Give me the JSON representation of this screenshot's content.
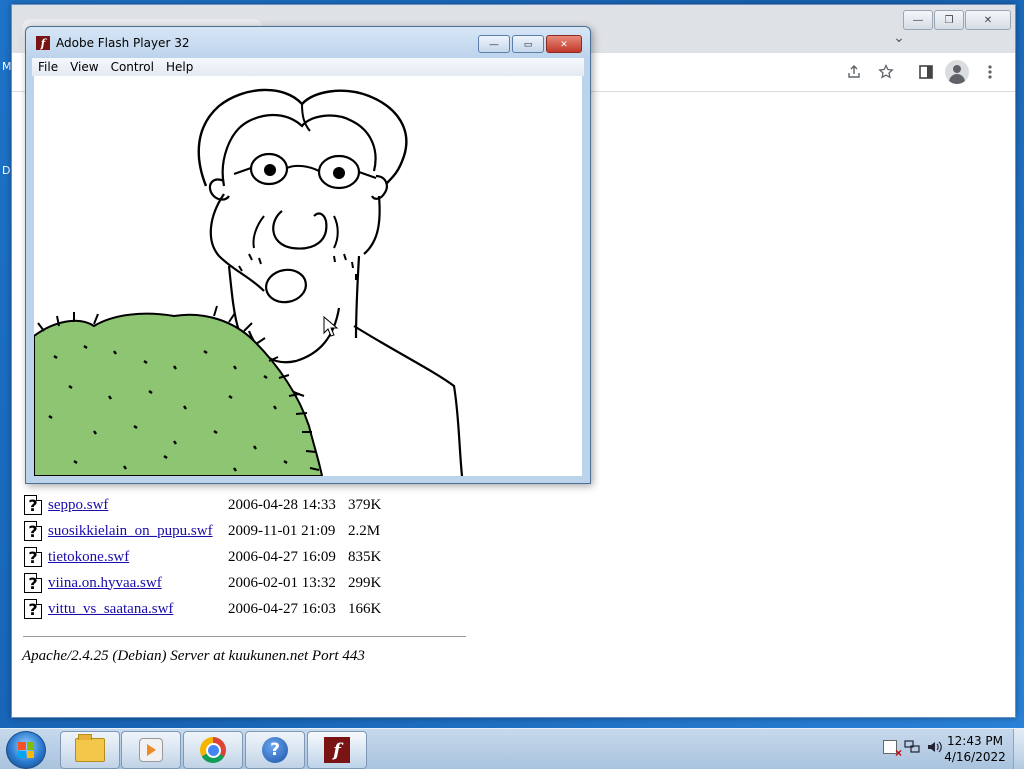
{
  "desktop": {
    "edge_letters": [
      "M",
      "D"
    ]
  },
  "chrome": {
    "caption": {
      "minimize": "—",
      "restore": "❐",
      "close": "✕"
    },
    "tab_search_glyph": "⌄",
    "toolbar_icons": [
      "share-icon",
      "star-icon",
      "side-panel-icon",
      "profile-icon",
      "menu-icon"
    ]
  },
  "listing": {
    "rows": [
      {
        "name": "seppo.swf",
        "date": "2006-04-28 14:33",
        "size": "379K"
      },
      {
        "name": "suosikkielain_on_pupu.swf",
        "date": "2009-11-01 21:09",
        "size": "2.2M"
      },
      {
        "name": "tietokone.swf",
        "date": "2006-04-27 16:09",
        "size": "835K"
      },
      {
        "name": "viina.on.hyvaa.swf",
        "date": "2006-02-01 13:32",
        "size": "299K"
      },
      {
        "name": "vittu_vs_saatana.swf",
        "date": "2006-04-27 16:03",
        "size": "166K"
      }
    ],
    "server_signature": "Apache/2.4.25 (Debian) Server at kuukunen.net Port 443"
  },
  "flash_window": {
    "title": "Adobe Flash Player 32",
    "menu": [
      "File",
      "View",
      "Control",
      "Help"
    ],
    "caption": {
      "minimize": "—",
      "maximize": "▭",
      "close": "✕"
    }
  },
  "taskbar": {
    "apps": [
      "explorer",
      "media-player",
      "chrome",
      "help",
      "flash-player"
    ],
    "clock_time": "12:43 PM",
    "clock_date": "4/16/2022"
  },
  "colors": {
    "link": "#1a0dab",
    "grass": "#8dc572",
    "flash_brand": "#7a1313"
  }
}
